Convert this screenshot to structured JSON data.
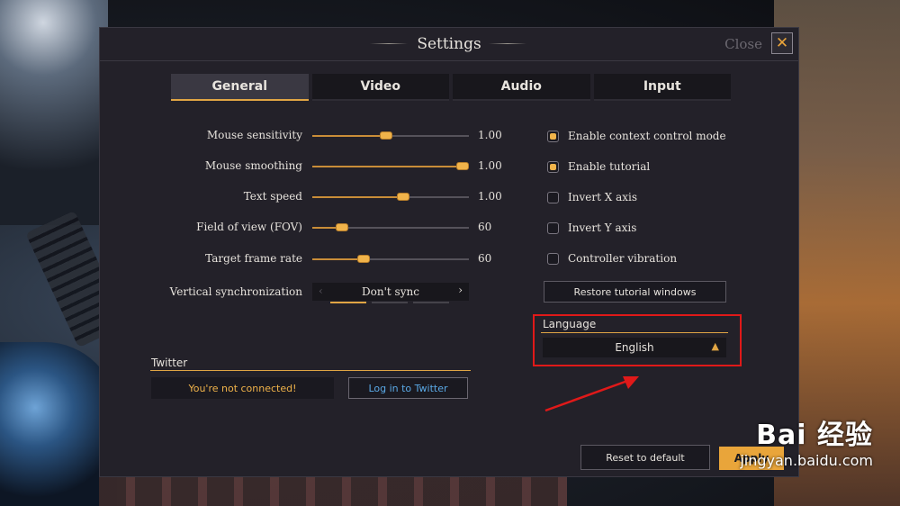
{
  "window": {
    "title": "Settings",
    "close_label": "Close",
    "close_glyph": "✕"
  },
  "tabs": [
    {
      "label": "General",
      "active": true
    },
    {
      "label": "Video",
      "active": false
    },
    {
      "label": "Audio",
      "active": false
    },
    {
      "label": "Input",
      "active": false
    }
  ],
  "sliders": [
    {
      "label": "Mouse sensitivity",
      "value": "1.00",
      "position": 0.47
    },
    {
      "label": "Mouse smoothing",
      "value": "1.00",
      "position": 0.96
    },
    {
      "label": "Text speed",
      "value": "1.00",
      "position": 0.58
    },
    {
      "label": "Field of view (FOV)",
      "value": "60",
      "position": 0.19
    },
    {
      "label": "Target frame rate",
      "value": "60",
      "position": 0.33
    }
  ],
  "vsync": {
    "label": "Vertical synchronization",
    "value": "Don't sync",
    "prev_glyph": "‹",
    "next_glyph": "›",
    "page": 1,
    "pages": 3
  },
  "checkboxes": [
    {
      "label": "Enable context control mode",
      "checked": true
    },
    {
      "label": "Enable tutorial",
      "checked": true
    },
    {
      "label": "Invert X axis",
      "checked": false
    },
    {
      "label": "Invert Y axis",
      "checked": false
    },
    {
      "label": "Controller vibration",
      "checked": false
    }
  ],
  "restore_button": "Restore tutorial windows",
  "language": {
    "header": "Language",
    "value": "English",
    "chevron": "▲"
  },
  "twitter": {
    "header": "Twitter",
    "status": "You're not connected!",
    "login_button": "Log in to Twitter"
  },
  "footer": {
    "reset_button": "Reset to default",
    "apply_button": "Apply"
  },
  "watermark": {
    "main": "Bai 经验",
    "sub": "jingyan.baidu.com"
  },
  "colors": {
    "accent": "#e0a544",
    "panel": "#232129",
    "annotation": "#e01919",
    "link": "#5aa9e6"
  }
}
